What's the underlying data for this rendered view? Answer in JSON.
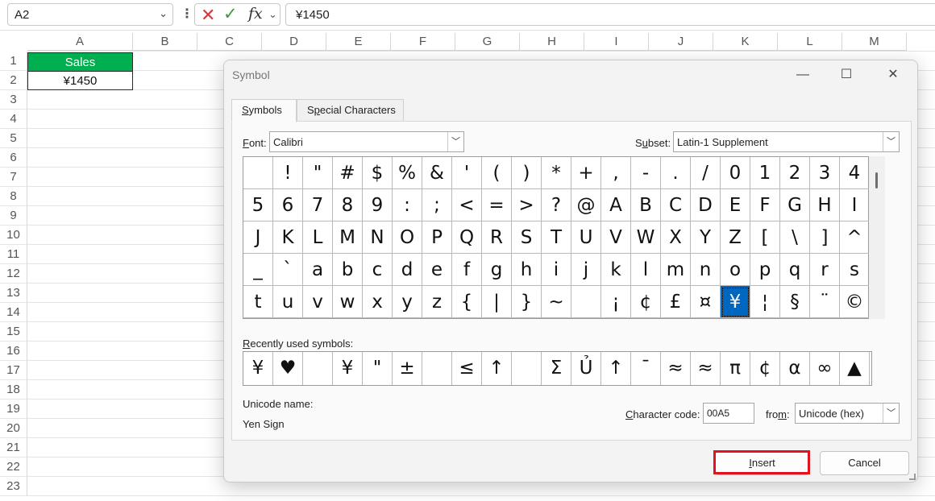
{
  "formula_bar": {
    "name_box": "A2",
    "cancel_icon": "✕",
    "enter_icon": "✓",
    "fx_label": "fx",
    "formula": "¥1450"
  },
  "sheet": {
    "columns": [
      "A",
      "B",
      "C",
      "D",
      "E",
      "F",
      "G",
      "H",
      "I",
      "J",
      "K",
      "L",
      "M"
    ],
    "rows": [
      "1",
      "2",
      "3",
      "4",
      "5",
      "6",
      "7",
      "8",
      "9",
      "10",
      "11",
      "12",
      "13",
      "14",
      "15",
      "16",
      "17",
      "18",
      "19",
      "20",
      "21",
      "22",
      "23"
    ],
    "a1": "Sales",
    "a2": "¥1450",
    "header_fill_color": "#00b050"
  },
  "dialog": {
    "title": "Symbol",
    "tabs": {
      "symbols_pre": "",
      "symbols_key": "S",
      "symbols_post": "ymbols",
      "special_pre": "S",
      "special_key": "p",
      "special_post": "ecial Characters"
    },
    "font": {
      "label_key": "F",
      "label_rest": "ont:",
      "value": "Calibri"
    },
    "subset": {
      "label_pre": "S",
      "label_key": "u",
      "label_post": "bset:",
      "value": "Latin-1 Supplement"
    },
    "symbol_rows": [
      [
        " ",
        "!",
        "\"",
        "#",
        "$",
        "%",
        "&",
        "'",
        "(",
        ")",
        "*",
        "+",
        ",",
        "-",
        ".",
        "/",
        "0",
        "1",
        "2",
        "3",
        "4"
      ],
      [
        "5",
        "6",
        "7",
        "8",
        "9",
        ":",
        ";",
        "<",
        "=",
        ">",
        "?",
        "@",
        "A",
        "B",
        "C",
        "D",
        "E",
        "F",
        "G",
        "H",
        "I"
      ],
      [
        "J",
        "K",
        "L",
        "M",
        "N",
        "O",
        "P",
        "Q",
        "R",
        "S",
        "T",
        "U",
        "V",
        "W",
        "X",
        "Y",
        "Z",
        "[",
        "\\",
        "]",
        "^"
      ],
      [
        "_",
        "`",
        "a",
        "b",
        "c",
        "d",
        "e",
        "f",
        "g",
        "h",
        "i",
        "j",
        "k",
        "l",
        "m",
        "n",
        "o",
        "p",
        "q",
        "r",
        "s"
      ],
      [
        "t",
        "u",
        "v",
        "w",
        "x",
        "y",
        "z",
        "{",
        "|",
        "}",
        "~",
        " ",
        "¡",
        "¢",
        "£",
        "¤",
        "¥",
        "¦",
        "§",
        "¨",
        "©"
      ]
    ],
    "selected_symbol": "¥",
    "recent_label_key": "R",
    "recent_label_rest": "ecently used symbols:",
    "recent_symbols": [
      "¥",
      "♥",
      " ",
      "¥",
      "\"",
      "±",
      " ",
      "≤",
      "↑",
      " ",
      "Σ",
      "Ủ",
      "↑",
      "ˉ",
      "≈",
      "≈",
      "π",
      "¢",
      "α",
      "∞",
      "▲"
    ],
    "unicode_name_label": "Unicode name:",
    "unicode_name": "Yen Sign",
    "char_code": {
      "label_key": "C",
      "label_rest": "haracter code:",
      "value": "00A5"
    },
    "from": {
      "label_pre": "fro",
      "label_key": "m",
      "label_post": ":",
      "value": "Unicode (hex)"
    },
    "insert_key": "I",
    "insert_rest": "nsert",
    "cancel_label": "Cancel",
    "highlight_color": "#e0141e"
  }
}
